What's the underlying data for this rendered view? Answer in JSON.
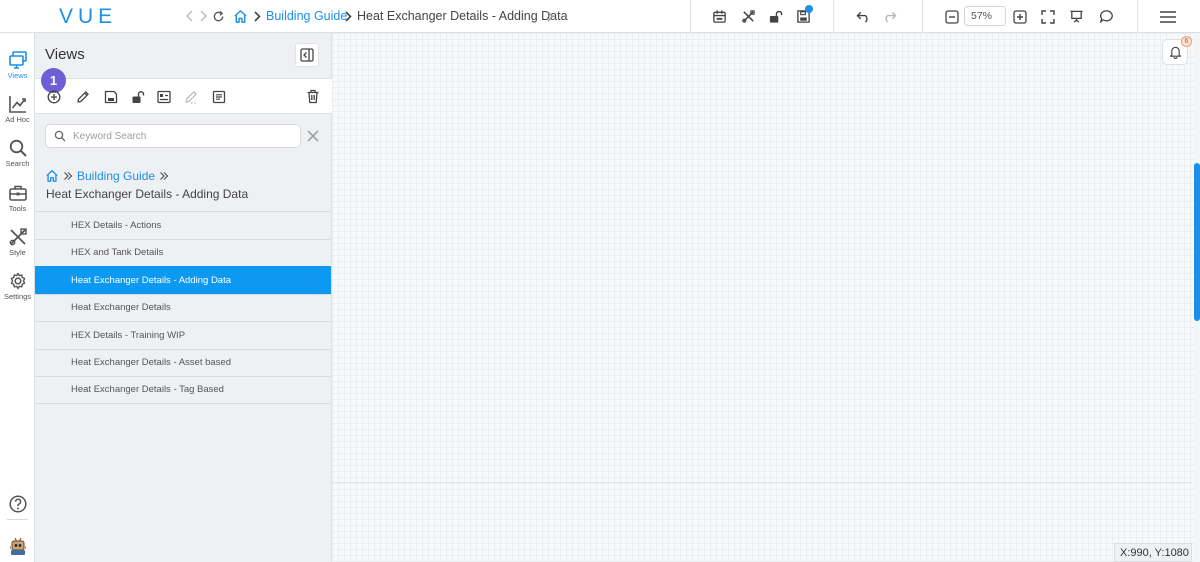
{
  "app": {
    "logo": "VUE"
  },
  "breadcrumb": {
    "parent": "Building Guide",
    "current": "Heat Exchanger Details - Adding Data"
  },
  "zoom": {
    "value": "57%"
  },
  "rail": {
    "items": [
      {
        "label": "Views",
        "icon": "views-icon"
      },
      {
        "label": "Ad Hoc",
        "icon": "chart-icon"
      },
      {
        "label": "Search",
        "icon": "search-icon"
      },
      {
        "label": "Tools",
        "icon": "toolbox-icon"
      },
      {
        "label": "Style",
        "icon": "style-icon"
      },
      {
        "label": "Settings",
        "icon": "gear-icon"
      }
    ]
  },
  "panel": {
    "title": "Views",
    "step_badge": "1",
    "search_placeholder": "Keyword Search",
    "breadcrumb_parent": "Building Guide",
    "current_view": "Heat Exchanger Details - Adding Data",
    "views": [
      "HEX Details - Actions",
      "HEX and Tank Details",
      "Heat Exchanger Details - Adding Data",
      "Heat Exchanger Details",
      "HEX Details - Training WIP",
      "Heat Exchanger Details - Asset based",
      "Heat Exchanger Details - Tag Based"
    ],
    "selected_index": 2
  },
  "notifications": {
    "count": "6"
  },
  "status": {
    "coordinates": "X:990, Y:1080"
  },
  "colors": {
    "accent": "#1c8fe8",
    "selected": "#0d99f2",
    "badge": "#6e5fd6"
  }
}
